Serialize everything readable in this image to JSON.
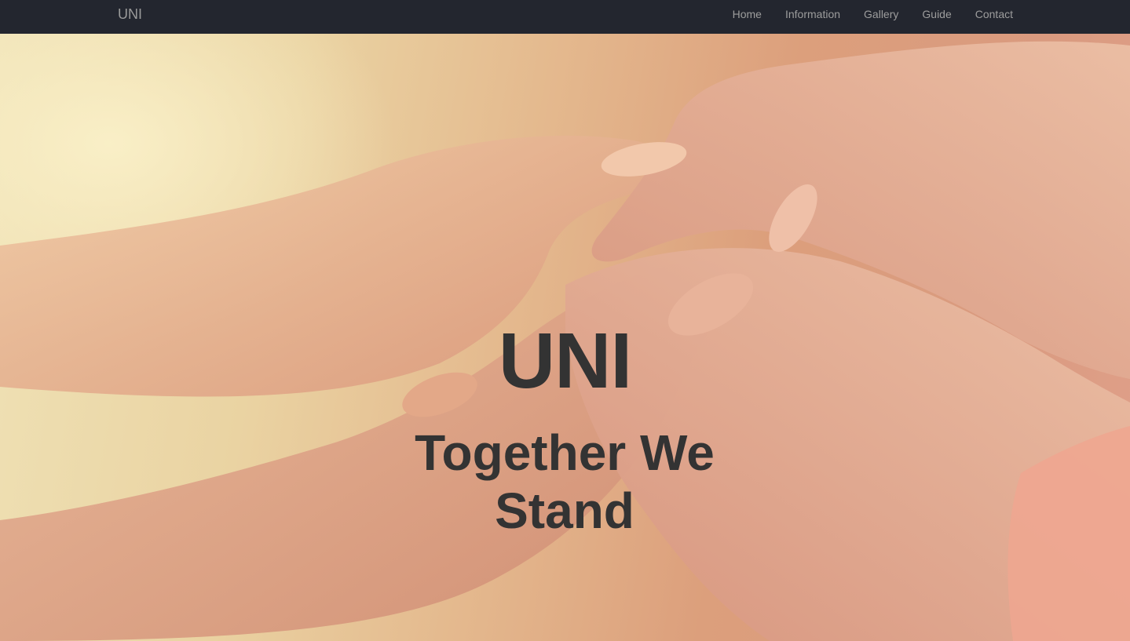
{
  "navbar": {
    "brand": "UNI",
    "items": [
      {
        "label": "Home"
      },
      {
        "label": "Information"
      },
      {
        "label": "Gallery"
      },
      {
        "label": "Guide"
      },
      {
        "label": "Contact"
      }
    ]
  },
  "hero": {
    "title": "UNI",
    "subtitle": "Together We Stand",
    "image_subject": "two pairs of hands holding each other"
  },
  "colors": {
    "navbar_bg": "#23262f",
    "nav_text": "#9d9d9d",
    "hero_text": "#333333"
  }
}
